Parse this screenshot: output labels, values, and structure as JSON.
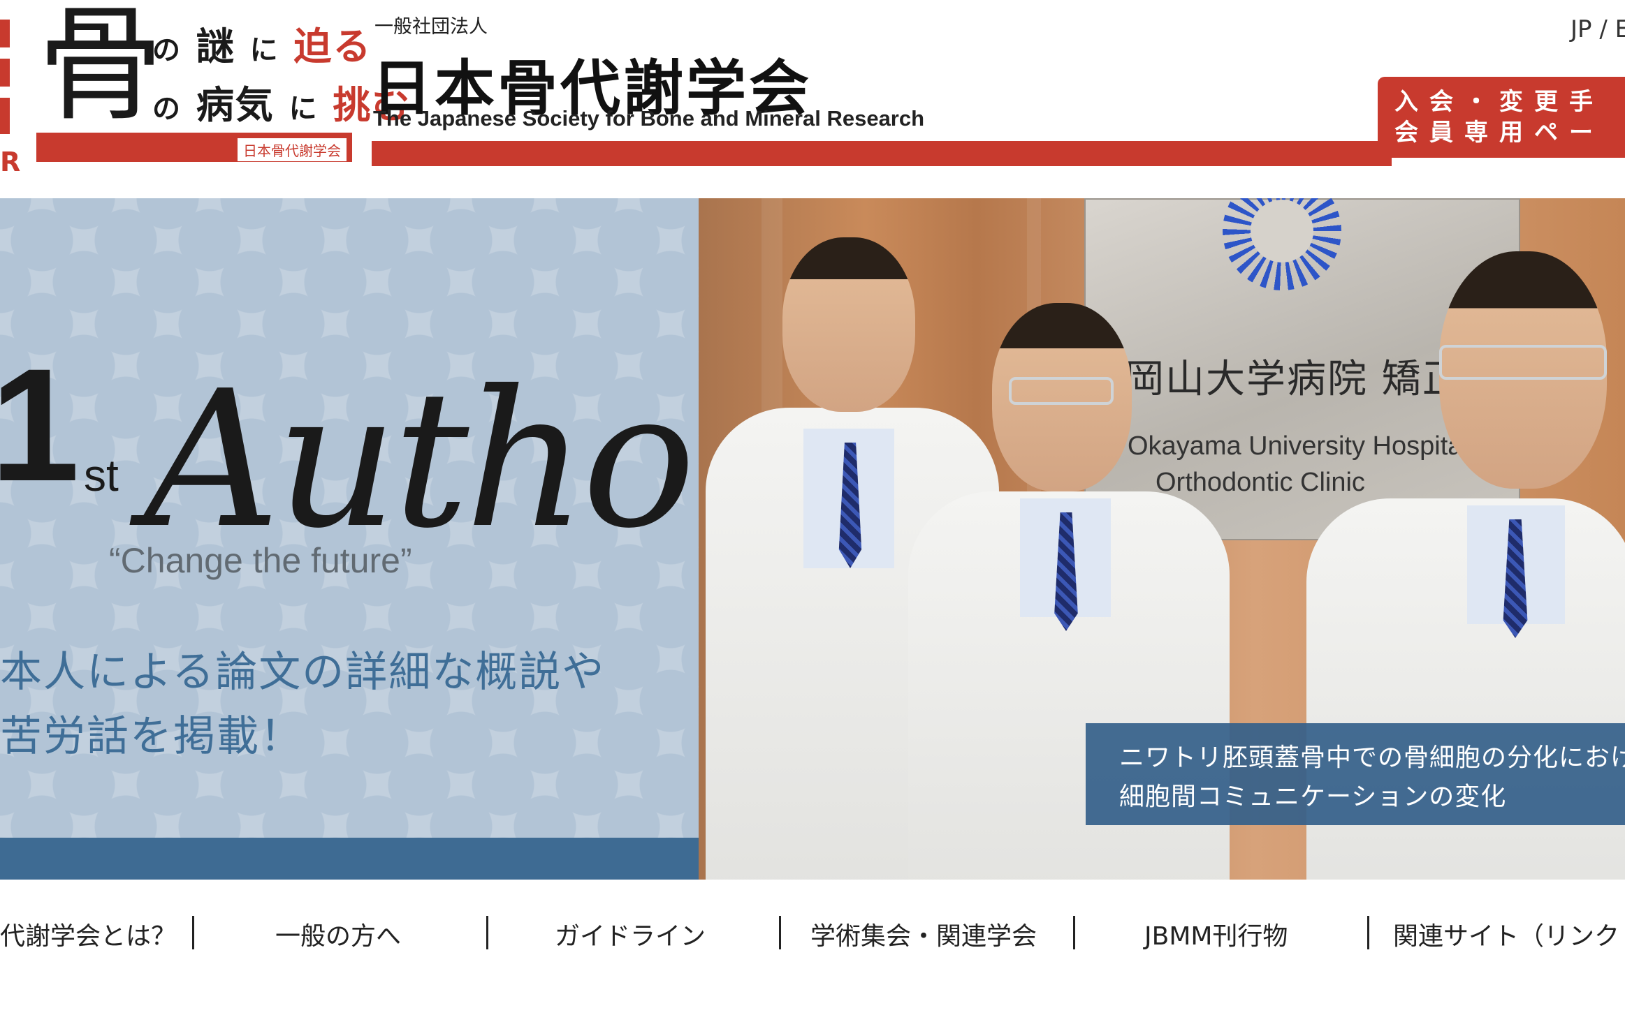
{
  "header": {
    "logo_mark_letter": "R",
    "tagline": {
      "bone_kanji": "骨",
      "row1": {
        "particle_no": "の",
        "riddle": "謎",
        "particle_ni": "に",
        "approach": "迫る"
      },
      "row2": {
        "particle_no": "の",
        "disease": "病気",
        "particle_ni": "に",
        "challenge": "挑む"
      },
      "society_label": "日本骨代謝学会"
    },
    "org_prefix": "一般社団法人",
    "org_name": "日本骨代謝学会",
    "org_name_en": "The Japanese Society for Bone and Mineral Research",
    "lang_switch": "JP / E",
    "member_box": {
      "line1": "入会・変更手",
      "line2": "会員専用ペー"
    }
  },
  "hero": {
    "feature": {
      "ordinal_number": "1",
      "ordinal_suffix": "st",
      "title_word": "Author",
      "motto": "“Change the future”",
      "catch_line1": "本人による論文の詳細な概説や",
      "catch_line2": "苦労話を掲載！"
    },
    "photo": {
      "sign_jp": "岡山大学病院 矯正歯科",
      "sign_en_line1": "Okayama University Hospital",
      "sign_en_line2": "Orthodontic Clinic"
    },
    "caption": {
      "line1": "ニワトリ胚頭蓋骨中での骨細胞の分化における",
      "line2": "細胞間コミュニケーションの変化"
    }
  },
  "nav": {
    "items": [
      {
        "label": "代謝学会とは？"
      },
      {
        "label": "一般の方へ"
      },
      {
        "label": "ガイドライン"
      },
      {
        "label": "学術集会・関連学会"
      },
      {
        "label": "JBMM刊行物"
      },
      {
        "label": "関連サイト（リンク"
      }
    ]
  },
  "colors": {
    "brand_red": "#c83a2e",
    "hero_blue": "#3e6b93",
    "catch_text_blue": "#3f6e97"
  }
}
